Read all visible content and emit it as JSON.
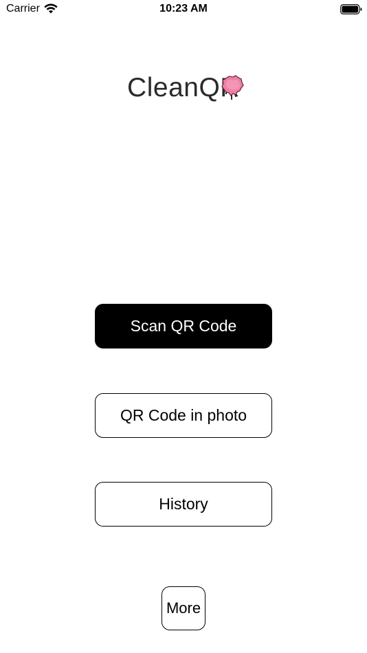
{
  "status_bar": {
    "carrier": "Carrier",
    "time": "10:23 AM",
    "wifi_icon": "wifi-icon",
    "battery_icon": "battery-icon"
  },
  "logo": {
    "text": "CleanQR",
    "splat_icon": "paint-splat-icon",
    "splat_color": "#f07fa6"
  },
  "buttons": {
    "scan": "Scan QR Code",
    "photo": "QR Code in photo",
    "history": "History",
    "more": "More"
  },
  "colors": {
    "primary": "#000000",
    "background": "#ffffff"
  }
}
